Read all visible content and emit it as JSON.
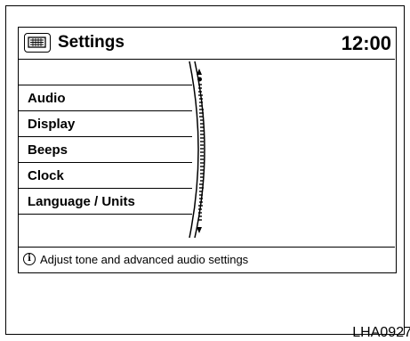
{
  "header": {
    "title": "Settings",
    "clock": "12:00",
    "menu_icon": "menu-icon"
  },
  "menu": {
    "items": [
      {
        "label": ""
      },
      {
        "label": "Audio"
      },
      {
        "label": "Display"
      },
      {
        "label": "Beeps"
      },
      {
        "label": "Clock"
      },
      {
        "label": "Language / Units"
      },
      {
        "label": ""
      }
    ]
  },
  "footer": {
    "info_text": "Adjust tone and advanced audio settings",
    "info_icon": "info-icon"
  },
  "figure_code": "LHA0927"
}
